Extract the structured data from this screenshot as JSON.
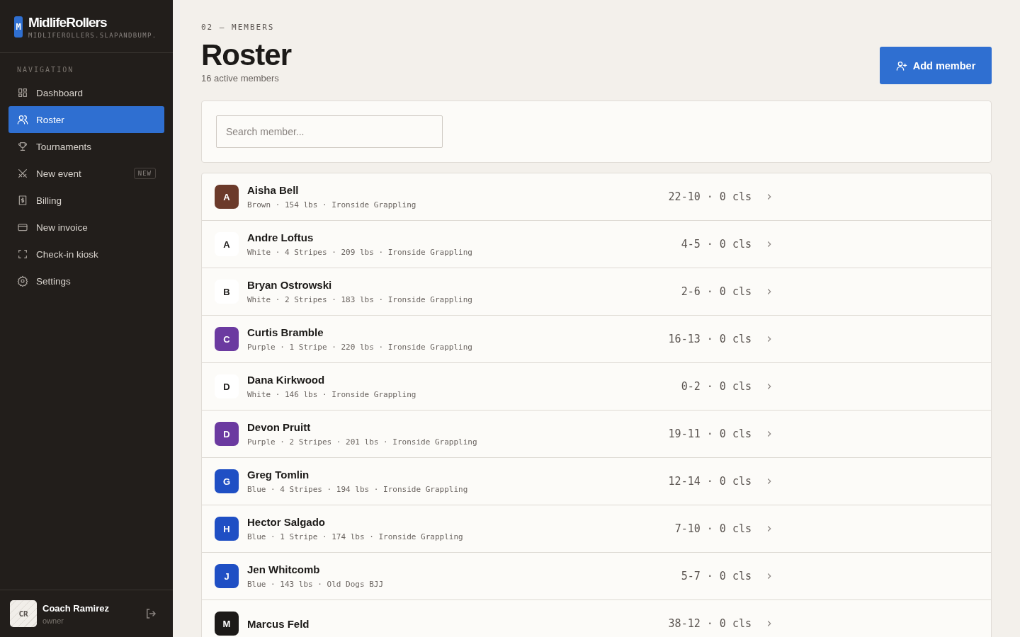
{
  "brand": {
    "logo": "M",
    "name": "MidlifeRollers",
    "domain": "MIDLIFEROLLERS.SLAPANDBUMP."
  },
  "sidebar": {
    "heading": "NAVIGATION",
    "items": [
      {
        "label": "Dashboard",
        "selected": false
      },
      {
        "label": "Roster",
        "selected": true
      },
      {
        "label": "Tournaments",
        "selected": false
      },
      {
        "label": "New event",
        "selected": false,
        "badge": "NEW"
      },
      {
        "label": "Billing",
        "selected": false
      },
      {
        "label": "New invoice",
        "selected": false
      },
      {
        "label": "Check-in kiosk",
        "selected": false
      },
      {
        "label": "Settings",
        "selected": false
      }
    ]
  },
  "user": {
    "initials": "CR",
    "name": "Coach Ramirez",
    "role": "owner"
  },
  "header": {
    "eyebrow": "02 — MEMBERS",
    "title": "Roster",
    "subtitle": "16 active members",
    "button": "Add member"
  },
  "search": {
    "placeholder": "Search member..."
  },
  "members": [
    {
      "initial": "A",
      "color": "#6b3a2a",
      "name": "Aisha Bell",
      "details": "Brown · 154 lbs · Ironside Grappling",
      "record": "22-10 · 0 cls"
    },
    {
      "initial": "A",
      "color": "#ffffff",
      "name": "Andre Loftus",
      "details": "White · 4 Stripes · 209 lbs · Ironside Grappling",
      "record": "4-5 · 0 cls"
    },
    {
      "initial": "B",
      "color": "#ffffff",
      "name": "Bryan Ostrowski",
      "details": "White · 2 Stripes · 183 lbs · Ironside Grappling",
      "record": "2-6 · 0 cls"
    },
    {
      "initial": "C",
      "color": "#6b3aa0",
      "name": "Curtis Bramble",
      "details": "Purple · 1 Stripe · 220 lbs · Ironside Grappling",
      "record": "16-13 · 0 cls"
    },
    {
      "initial": "D",
      "color": "#ffffff",
      "name": "Dana Kirkwood",
      "details": "White · 146 lbs · Ironside Grappling",
      "record": "0-2 · 0 cls"
    },
    {
      "initial": "D",
      "color": "#6b3aa0",
      "name": "Devon Pruitt",
      "details": "Purple · 2 Stripes · 201 lbs · Ironside Grappling",
      "record": "19-11 · 0 cls"
    },
    {
      "initial": "G",
      "color": "#1f4fc4",
      "name": "Greg Tomlin",
      "details": "Blue · 4 Stripes · 194 lbs · Ironside Grappling",
      "record": "12-14 · 0 cls"
    },
    {
      "initial": "H",
      "color": "#1f4fc4",
      "name": "Hector Salgado",
      "details": "Blue · 1 Stripe · 174 lbs · Ironside Grappling",
      "record": "7-10 · 0 cls"
    },
    {
      "initial": "J",
      "color": "#1f4fc4",
      "name": "Jen Whitcomb",
      "details": "Blue · 143 lbs · Old Dogs BJJ",
      "record": "5-7 · 0 cls"
    },
    {
      "initial": "M",
      "color": "#1c1a18",
      "name": "Marcus Feld",
      "record": "38-12 · 0 cls"
    }
  ]
}
